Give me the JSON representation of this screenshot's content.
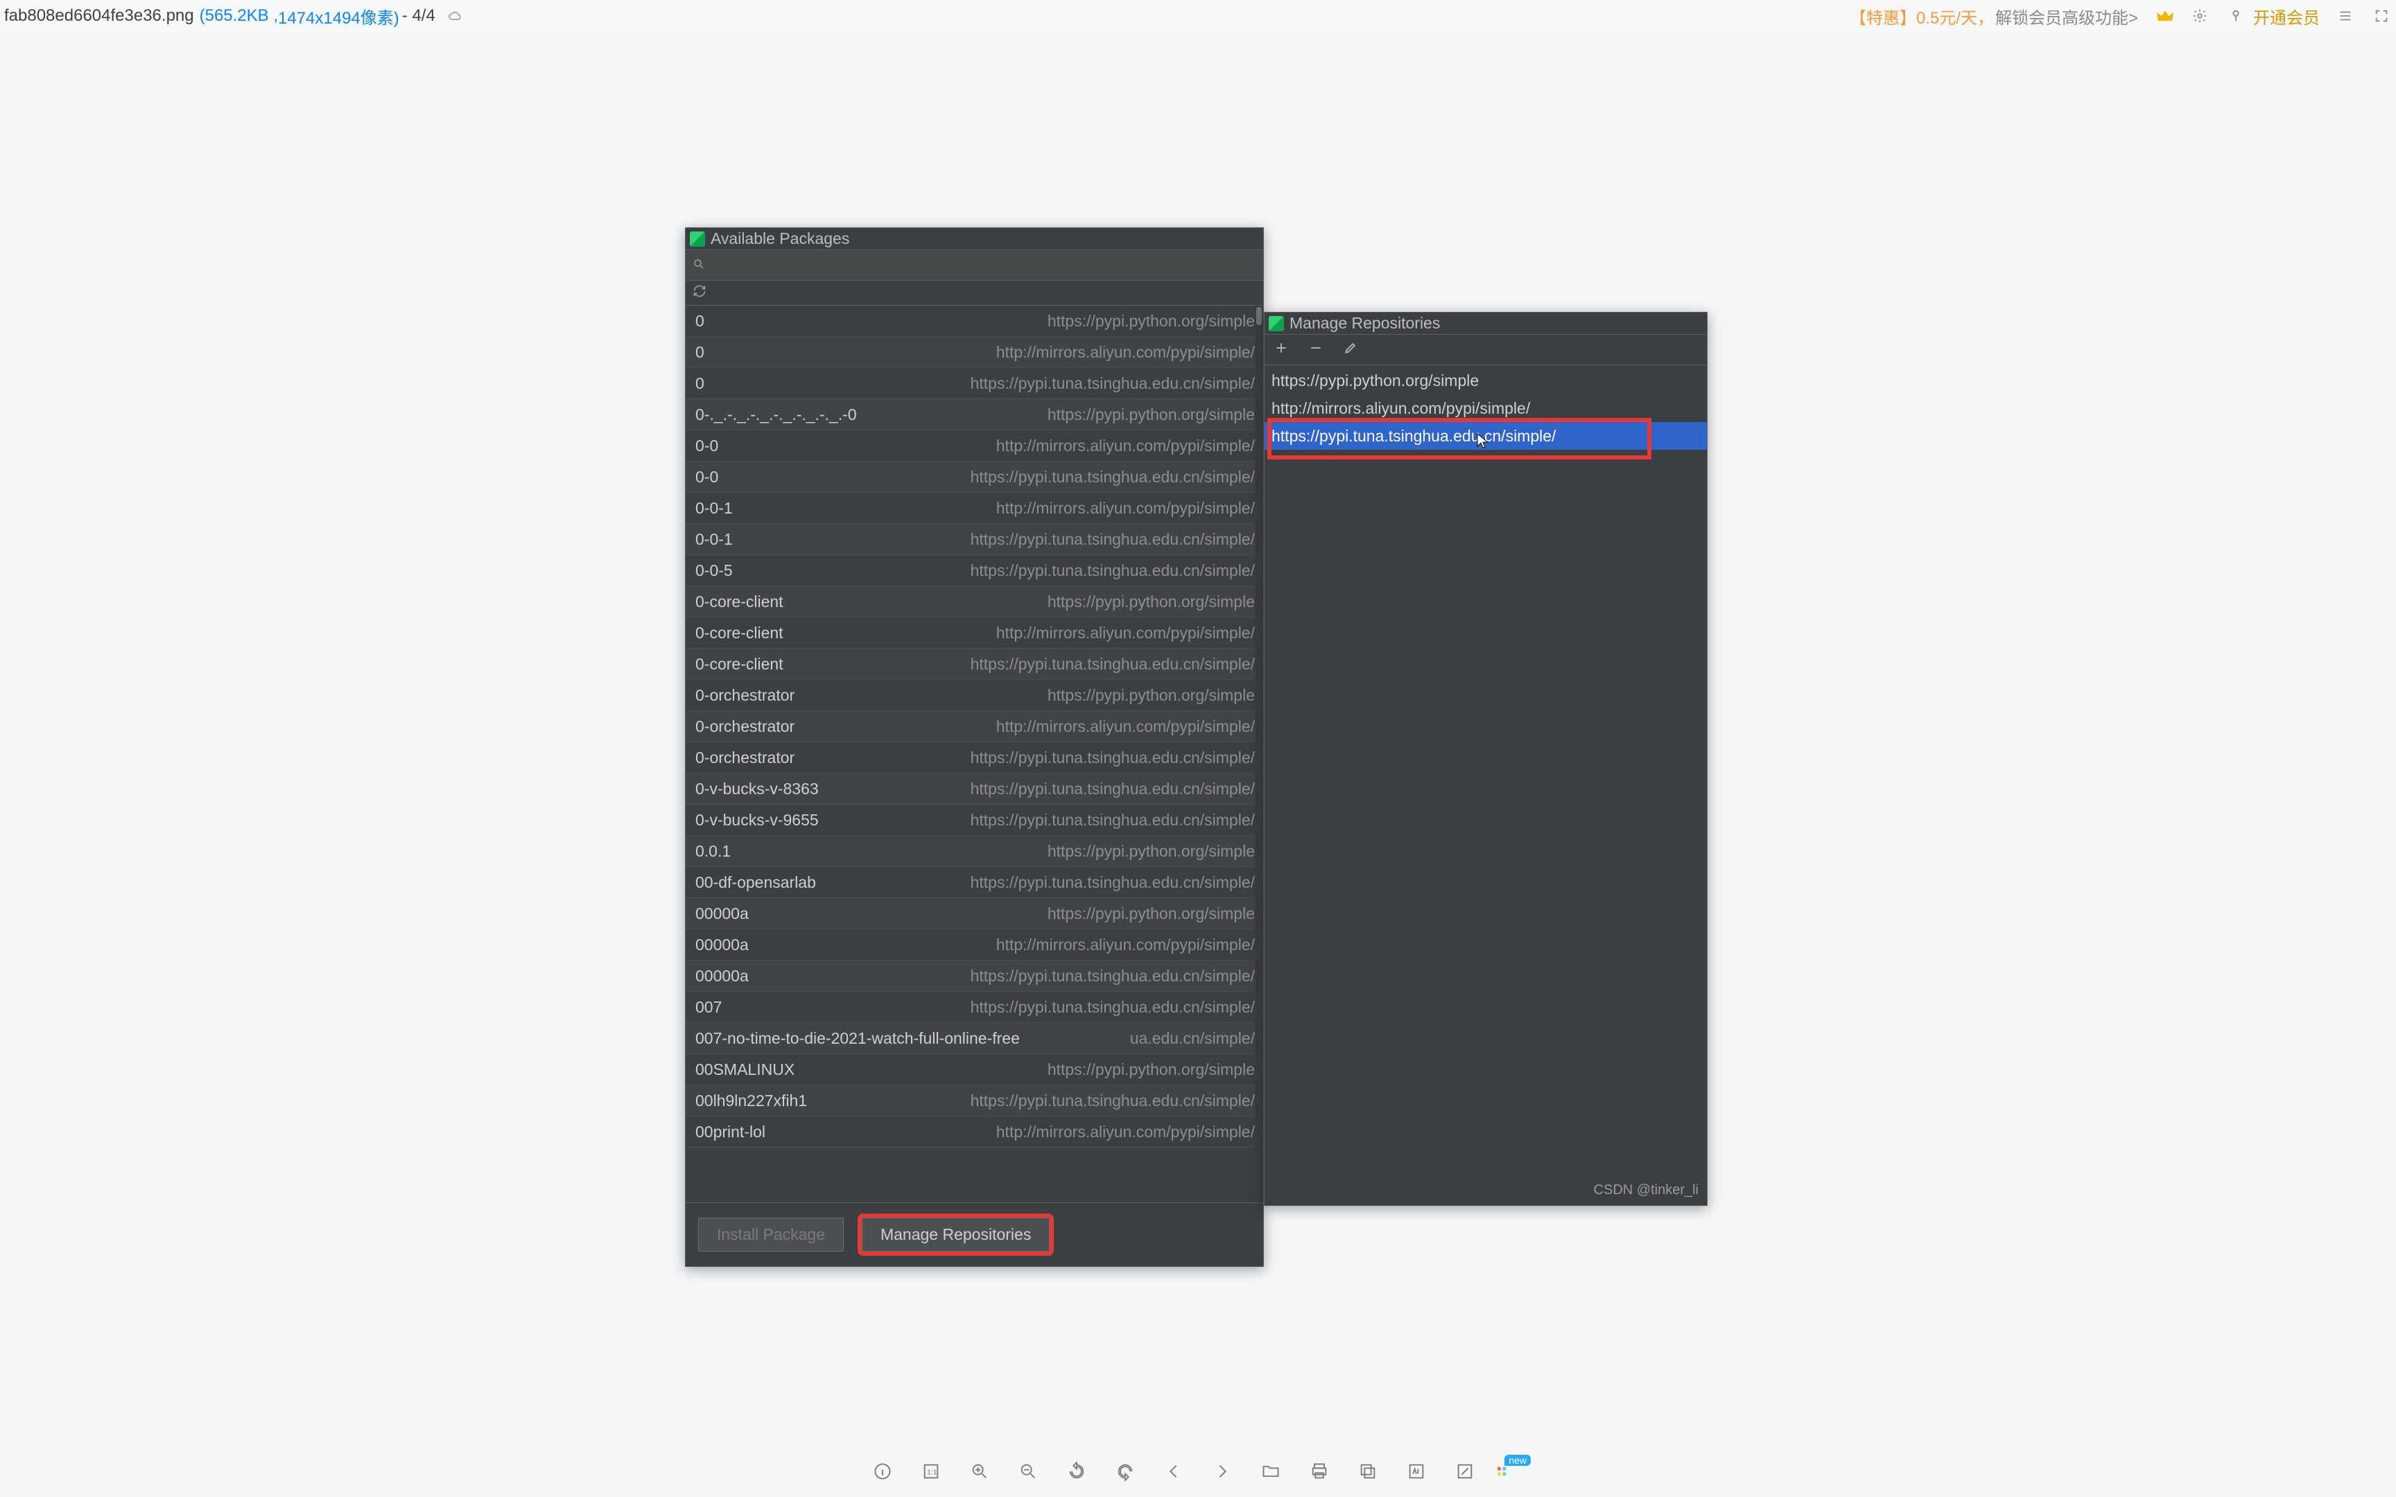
{
  "viewer": {
    "filename": "fab808ed6604fe3e36.png",
    "filesize": "(565.2KB ,",
    "dimensions": " 1474x1494像素)",
    "page": " - 4/4",
    "promo_a": "【特惠】0.5元/天，",
    "promo_b": "解锁会员高级功能>",
    "vip_text": "开通会员",
    "cloud_icon": "cloud"
  },
  "packages_dialog": {
    "title": "Available Packages",
    "search_placeholder": "",
    "install_btn": "Install Package",
    "manage_btn": "Manage Repositories",
    "rows": [
      {
        "name": "0",
        "src": "https://pypi.python.org/simple"
      },
      {
        "name": "0",
        "src": "http://mirrors.aliyun.com/pypi/simple/"
      },
      {
        "name": "0",
        "src": "https://pypi.tuna.tsinghua.edu.cn/simple/"
      },
      {
        "name": "0-._.-._.-._.-._.-._.-._.-0",
        "src": "https://pypi.python.org/simple"
      },
      {
        "name": "0-0",
        "src": "http://mirrors.aliyun.com/pypi/simple/"
      },
      {
        "name": "0-0",
        "src": "https://pypi.tuna.tsinghua.edu.cn/simple/"
      },
      {
        "name": "0-0-1",
        "src": "http://mirrors.aliyun.com/pypi/simple/"
      },
      {
        "name": "0-0-1",
        "src": "https://pypi.tuna.tsinghua.edu.cn/simple/"
      },
      {
        "name": "0-0-5",
        "src": "https://pypi.tuna.tsinghua.edu.cn/simple/"
      },
      {
        "name": "0-core-client",
        "src": "https://pypi.python.org/simple"
      },
      {
        "name": "0-core-client",
        "src": "http://mirrors.aliyun.com/pypi/simple/"
      },
      {
        "name": "0-core-client",
        "src": "https://pypi.tuna.tsinghua.edu.cn/simple/"
      },
      {
        "name": "0-orchestrator",
        "src": "https://pypi.python.org/simple"
      },
      {
        "name": "0-orchestrator",
        "src": "http://mirrors.aliyun.com/pypi/simple/"
      },
      {
        "name": "0-orchestrator",
        "src": "https://pypi.tuna.tsinghua.edu.cn/simple/"
      },
      {
        "name": "0-v-bucks-v-8363",
        "src": "https://pypi.tuna.tsinghua.edu.cn/simple/"
      },
      {
        "name": "0-v-bucks-v-9655",
        "src": "https://pypi.tuna.tsinghua.edu.cn/simple/"
      },
      {
        "name": "0.0.1",
        "src": "https://pypi.python.org/simple"
      },
      {
        "name": "00-df-opensarlab",
        "src": "https://pypi.tuna.tsinghua.edu.cn/simple/"
      },
      {
        "name": "00000a",
        "src": "https://pypi.python.org/simple"
      },
      {
        "name": "00000a",
        "src": "http://mirrors.aliyun.com/pypi/simple/"
      },
      {
        "name": "00000a",
        "src": "https://pypi.tuna.tsinghua.edu.cn/simple/"
      },
      {
        "name": "007",
        "src": "https://pypi.tuna.tsinghua.edu.cn/simple/"
      },
      {
        "name": "007-no-time-to-die-2021-watch-full-online-free",
        "src": "ua.edu.cn/simple/"
      },
      {
        "name": "00SMALINUX",
        "src": "https://pypi.python.org/simple"
      },
      {
        "name": "00lh9ln227xfih1",
        "src": "https://pypi.tuna.tsinghua.edu.cn/simple/"
      },
      {
        "name": "00print-lol",
        "src": "http://mirrors.aliyun.com/pypi/simple/"
      }
    ]
  },
  "repos_dialog": {
    "title": "Manage Repositories",
    "items": [
      {
        "url": "https://pypi.python.org/simple",
        "selected": false
      },
      {
        "url": "http://mirrors.aliyun.com/pypi/simple/",
        "selected": false
      },
      {
        "url": "https://pypi.tuna.tsinghua.edu.cn/simple/",
        "selected": true
      }
    ]
  },
  "watermark": "CSDN @tinker_li",
  "bottom_toolbar": {
    "items": [
      "info",
      "actual-size",
      "zoom-in",
      "zoom-out",
      "rotate-ccw",
      "rotate-cw",
      "prev",
      "next",
      "open-folder",
      "print",
      "copy",
      "ocr",
      "edit",
      "apps"
    ],
    "new_badge": "new"
  }
}
